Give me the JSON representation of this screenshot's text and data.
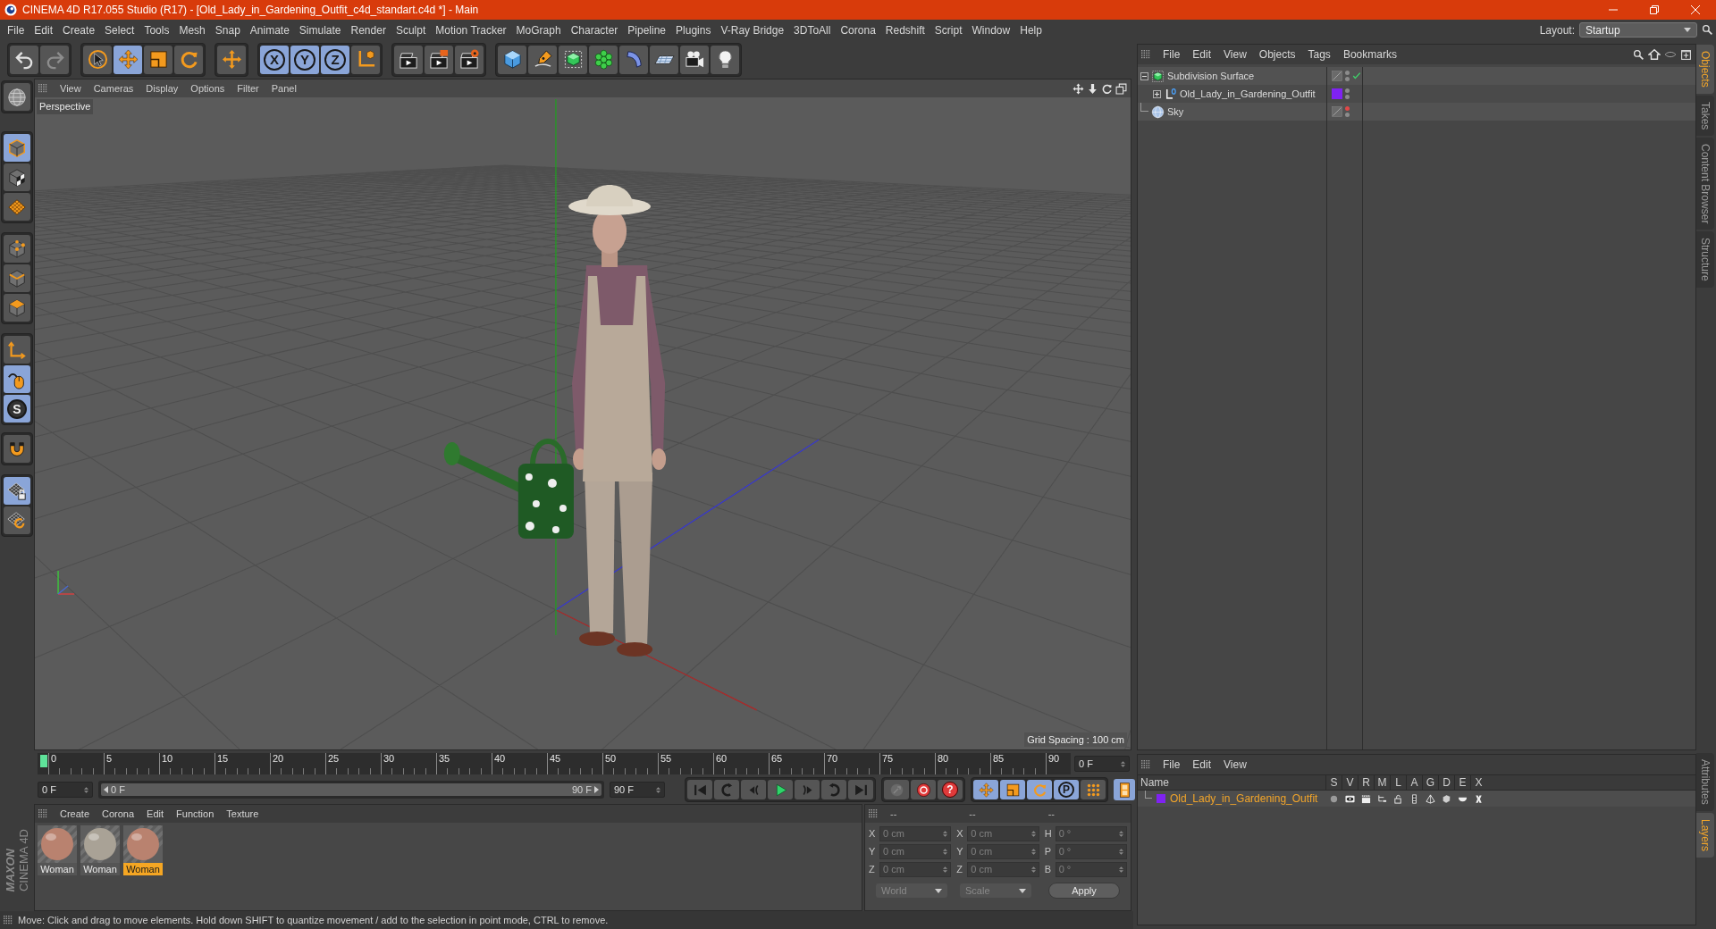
{
  "window": {
    "title": "CINEMA 4D R17.055 Studio (R17) - [Old_Lady_in_Gardening_Outfit_c4d_standart.c4d *] - Main"
  },
  "menu_bar": [
    "File",
    "Edit",
    "Create",
    "Select",
    "Tools",
    "Mesh",
    "Snap",
    "Animate",
    "Simulate",
    "Render",
    "Sculpt",
    "Motion Tracker",
    "MoGraph",
    "Character",
    "Pipeline",
    "Plugins",
    "V-Ray Bridge",
    "3DToAll",
    "Corona",
    "Redshift",
    "Script",
    "Window",
    "Help"
  ],
  "layout": {
    "label": "Layout:",
    "value": "Startup"
  },
  "toolbar": [
    [
      {
        "kind": "undo",
        "disabled": false
      },
      {
        "kind": "redo",
        "disabled": true
      }
    ],
    [
      {
        "kind": "select",
        "selected": false
      },
      {
        "kind": "move",
        "selected": true
      },
      {
        "kind": "scale",
        "selected": false
      },
      {
        "kind": "rotate",
        "selected": false
      }
    ],
    [
      {
        "kind": "recent",
        "selected": false
      }
    ],
    [
      {
        "kind": "axis",
        "label": "X",
        "selected": true
      },
      {
        "kind": "axis",
        "label": "Y",
        "selected": true
      },
      {
        "kind": "axis",
        "label": "Z",
        "selected": true
      },
      {
        "kind": "coords",
        "selected": false
      }
    ],
    [
      {
        "kind": "render_view",
        "selected": false
      },
      {
        "kind": "render",
        "selected": false
      },
      {
        "kind": "render_settings",
        "selected": false
      }
    ],
    [
      {
        "kind": "cube",
        "selected": false
      },
      {
        "kind": "pen",
        "selected": false
      },
      {
        "kind": "subdivision",
        "selected": false
      },
      {
        "kind": "cloner",
        "selected": false
      },
      {
        "kind": "deformer",
        "selected": false
      },
      {
        "kind": "floor",
        "selected": false
      },
      {
        "kind": "camera",
        "selected": false
      },
      {
        "kind": "light",
        "selected": false
      }
    ]
  ],
  "modes": [
    [
      {
        "kind": "globe",
        "selected": false
      }
    ],
    [
      {
        "kind": "model",
        "selected": true
      },
      {
        "kind": "texture",
        "selected": false
      },
      {
        "kind": "workplane",
        "selected": false
      }
    ],
    [
      {
        "kind": "points",
        "selected": false
      },
      {
        "kind": "edges",
        "selected": false
      },
      {
        "kind": "polygons",
        "selected": false
      }
    ],
    [
      {
        "kind": "axis_mode",
        "selected": false
      },
      {
        "kind": "tweak",
        "selected": true
      },
      {
        "kind": "solo",
        "label": "S",
        "selected": true
      }
    ],
    [
      {
        "kind": "magnet",
        "selected": false
      }
    ],
    [
      {
        "kind": "grid_lock",
        "selected": true
      },
      {
        "kind": "grid_rotate",
        "selected": false
      }
    ]
  ],
  "logo": {
    "brand": "MAXON",
    "product": "CINEMA 4D"
  },
  "viewport": {
    "menu": [
      "View",
      "Cameras",
      "Display",
      "Options",
      "Filter",
      "Panel"
    ],
    "camera": "Perspective",
    "grid_spacing": "Grid Spacing : 100 cm"
  },
  "timeline": {
    "ticks": [
      "0",
      "5",
      "10",
      "15",
      "20",
      "25",
      "30",
      "35",
      "40",
      "45",
      "50",
      "55",
      "60",
      "65",
      "70",
      "75",
      "80",
      "85",
      "90"
    ],
    "frame": "0 F"
  },
  "playback": {
    "start": "0 F",
    "range": {
      "start": "0 F",
      "end": "90 F",
      "level": 1
    },
    "end": "90 F",
    "transport": [
      {
        "kind": "first"
      },
      {
        "kind": "prev_key"
      },
      {
        "kind": "prev_frame"
      },
      {
        "kind": "play"
      },
      {
        "kind": "next_frame"
      },
      {
        "kind": "next_key"
      },
      {
        "kind": "last"
      }
    ],
    "keys": [
      {
        "kind": "keyframe",
        "disabled": true
      },
      {
        "kind": "record",
        "disabled": false
      },
      {
        "kind": "autokey",
        "label": "?",
        "disabled": false
      }
    ],
    "key_modes": [
      {
        "kind": "move",
        "selected": true
      },
      {
        "kind": "scale",
        "selected": true
      },
      {
        "kind": "rotate",
        "selected": true
      },
      {
        "kind": "param",
        "label": "P",
        "selected": true
      },
      {
        "kind": "pla",
        "selected": false
      }
    ],
    "timeline_toggle": {
      "kind": "filmstrip",
      "selected": true
    }
  },
  "materials": {
    "menu": [
      "Create",
      "Corona",
      "Edit",
      "Function",
      "Texture"
    ],
    "items": [
      {
        "name": "Woman",
        "color": "#b9826f",
        "selected": false
      },
      {
        "name": "Woman",
        "color": "#a9a296",
        "selected": false
      },
      {
        "name": "Woman",
        "color": "#b9826f",
        "selected": true
      }
    ]
  },
  "coordinates": {
    "headers": [
      "--",
      "--",
      "--"
    ],
    "rows": [
      [
        {
          "axis": "X",
          "value": "0 cm"
        },
        {
          "axis": "X",
          "value": "0 cm"
        },
        {
          "axis": "H",
          "value": "0 °"
        }
      ],
      [
        {
          "axis": "Y",
          "value": "0 cm"
        },
        {
          "axis": "Y",
          "value": "0 cm"
        },
        {
          "axis": "P",
          "value": "0 °"
        }
      ],
      [
        {
          "axis": "Z",
          "value": "0 cm"
        },
        {
          "axis": "Z",
          "value": "0 cm"
        },
        {
          "axis": "B",
          "value": "0 °"
        }
      ]
    ],
    "dropdowns": [
      {
        "value": "World",
        "disabled": true
      },
      {
        "value": "Scale",
        "disabled": true
      }
    ],
    "apply": "Apply"
  },
  "status_bar": "Move: Click and drag to move elements. Hold down SHIFT to quantize movement / add to the selection in point mode, CTRL to remove.",
  "objects": {
    "menu": [
      "File",
      "Edit",
      "View",
      "Objects",
      "Tags",
      "Bookmarks"
    ],
    "items": [
      {
        "kind": "subdivision",
        "name": "Subdivision Surface",
        "expanded": true,
        "visible_in_editor": true,
        "enabled": true,
        "children": [
          {
            "kind": "null",
            "name": "Old_Lady_in_Gardening_Outfit",
            "expanded": false,
            "color": "#7f22f2",
            "visible_in_editor": true
          }
        ]
      },
      {
        "kind": "sky",
        "name": "Sky",
        "visible_in_editor": false
      }
    ]
  },
  "layers": {
    "menu": [
      "File",
      "Edit",
      "View"
    ],
    "columns": [
      "Name",
      "S",
      "V",
      "R",
      "M",
      "L",
      "A",
      "G",
      "D",
      "E",
      "X"
    ],
    "rows": [
      {
        "name": "Old_Lady_in_Gardening_Outfit",
        "color": "#7f22f2",
        "selected": true
      }
    ]
  },
  "side_tabs": {
    "top": [
      {
        "label": "Objects",
        "selected": true
      },
      {
        "label": "Takes",
        "selected": false
      },
      {
        "label": "Content Browser",
        "selected": false
      },
      {
        "label": "Structure",
        "selected": false
      }
    ],
    "bottom": [
      {
        "label": "Attributes",
        "selected": false
      },
      {
        "label": "Layers",
        "selected": true
      }
    ]
  }
}
